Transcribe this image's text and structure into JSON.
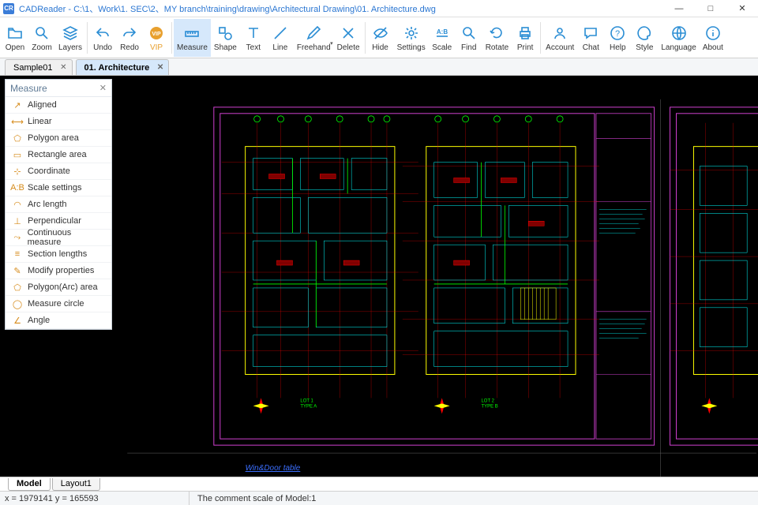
{
  "window": {
    "app_icon_text": "CR",
    "title": "CADReader - C:\\1、Work\\1. SEC\\2、MY branch\\training\\drawing\\Architectural Drawing\\01. Architecture.dwg",
    "btn_min": "—",
    "btn_max": "□",
    "btn_close": "✕"
  },
  "toolbar": {
    "open": "Open",
    "zoom": "Zoom",
    "layers": "Layers",
    "undo": "Undo",
    "redo": "Redo",
    "vip": "VIP",
    "measure": "Measure",
    "shape": "Shape",
    "text": "Text",
    "line": "Line",
    "freehand": "Freehand",
    "delete": "Delete",
    "hide": "Hide",
    "settings": "Settings",
    "scale": "Scale",
    "find": "Find",
    "rotate": "Rotate",
    "print": "Print",
    "account": "Account",
    "chat": "Chat",
    "help": "Help",
    "style": "Style",
    "language": "Language",
    "about": "About"
  },
  "tabs": [
    {
      "label": "Sample01",
      "active": false
    },
    {
      "label": "01. Architecture",
      "active": true
    }
  ],
  "measure_panel": {
    "title": "Measure",
    "items": [
      "Aligned",
      "Linear",
      "Polygon area",
      "Rectangle area",
      "Coordinate",
      "Scale settings",
      "Arc length",
      "Perpendicular",
      "Continuous measure",
      "Section lengths",
      "Modify properties",
      "Polygon(Arc) area",
      "Measure circle",
      "Angle"
    ]
  },
  "canvas_link": "Win&Door table",
  "bottom_tabs": [
    {
      "label": "Model",
      "active": true
    },
    {
      "label": "Layout1",
      "active": false
    }
  ],
  "status": {
    "coords": "x = 1979141  y = 165593",
    "scale": "The comment scale of Model:1"
  },
  "colors": {
    "accent": "#2a8dd4",
    "magenta": "#d040d0",
    "cyan": "#00ffff",
    "green": "#00ff00",
    "red": "#ff0000",
    "yellow": "#ffff00"
  }
}
